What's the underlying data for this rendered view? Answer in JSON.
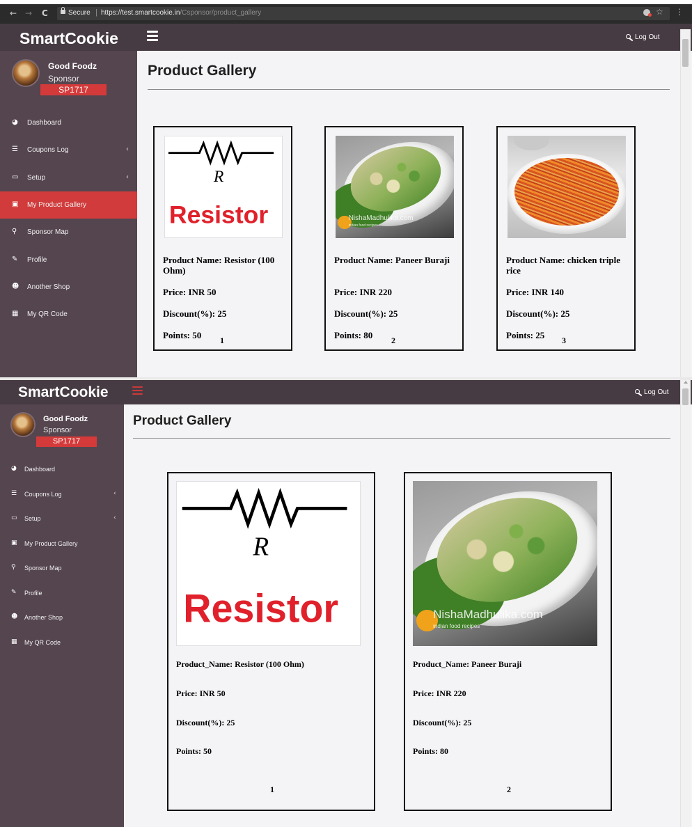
{
  "browser": {
    "secure_label": "Secure",
    "url_host": "https://test.smartcookie.in",
    "url_path": "/Csponsor/product_gallery",
    "back_glyph": "←",
    "forward_glyph": "→",
    "reload_glyph": "C",
    "star_glyph": "☆",
    "menu_glyph": "⋮"
  },
  "app": {
    "brand": "SmartCookie",
    "logout_label": "Log Out",
    "page_title": "Product Gallery"
  },
  "user": {
    "name": "Good Foodz",
    "role": "Sponsor",
    "id": "SP1717"
  },
  "sidebar": {
    "items": [
      {
        "label": "Dashboard",
        "icon": "dashboard-icon",
        "glyph": "◕",
        "has_chevron": false
      },
      {
        "label": "Coupons Log",
        "icon": "database-icon",
        "glyph": "☰",
        "has_chevron": true
      },
      {
        "label": "Setup",
        "icon": "monitor-icon",
        "glyph": "▭",
        "has_chevron": true
      },
      {
        "label": "My Product Gallery",
        "icon": "image-icon",
        "glyph": "▣",
        "has_chevron": false
      },
      {
        "label": "Sponsor Map",
        "icon": "map-marker-icon",
        "glyph": "⚲",
        "has_chevron": false
      },
      {
        "label": "Profile",
        "icon": "edit-icon",
        "glyph": "✎",
        "has_chevron": false
      },
      {
        "label": "Another Shop",
        "icon": "users-icon",
        "glyph": "☻",
        "has_chevron": false
      },
      {
        "label": "My QR Code",
        "icon": "qrcode-icon",
        "glyph": "▦",
        "has_chevron": false
      }
    ],
    "chevron_glyph": "‹",
    "active_index": 3
  },
  "panel1": {
    "products": [
      {
        "name_label": "Product Name:",
        "name": "Resistor (100 Ohm)",
        "price": "Price: INR 50",
        "discount": "Discount(%): 25",
        "points": "Points: 50",
        "index": "1",
        "image": "resistor"
      },
      {
        "name_label": "Product Name:",
        "name": "Paneer Buraji",
        "price": "Price: INR 220",
        "discount": "Discount(%): 25",
        "points": "Points: 80",
        "index": "2",
        "image": "paneer"
      },
      {
        "name_label": "Product Name:",
        "name": "chicken triple rice",
        "price": "Price: INR 140",
        "discount": "Discount(%): 25",
        "points": "Points: 25",
        "index": "3",
        "image": "noodles"
      }
    ]
  },
  "panel2": {
    "products": [
      {
        "name_full": "Product_Name: Resistor (100 Ohm)",
        "price": "Price: INR 50",
        "discount": "Discount(%): 25",
        "points": "Points: 50",
        "index": "1",
        "image": "resistor"
      },
      {
        "name_full": "Product_Name: Paneer Buraji",
        "price": "Price: INR 220",
        "discount": "Discount(%): 25",
        "points": "Points: 80",
        "index": "2",
        "image": "paneer"
      }
    ]
  },
  "images": {
    "resistor_symbol": "R",
    "resistor_word": "Resistor",
    "watermark": "NishaMadhulika.com",
    "watermark_sub": "indian food recipes"
  },
  "colors": {
    "sidebar_bg": "#55454f",
    "topbar_bg": "#473b43",
    "accent_red": "#d13b3b",
    "content_bg": "#f4f3f6"
  }
}
